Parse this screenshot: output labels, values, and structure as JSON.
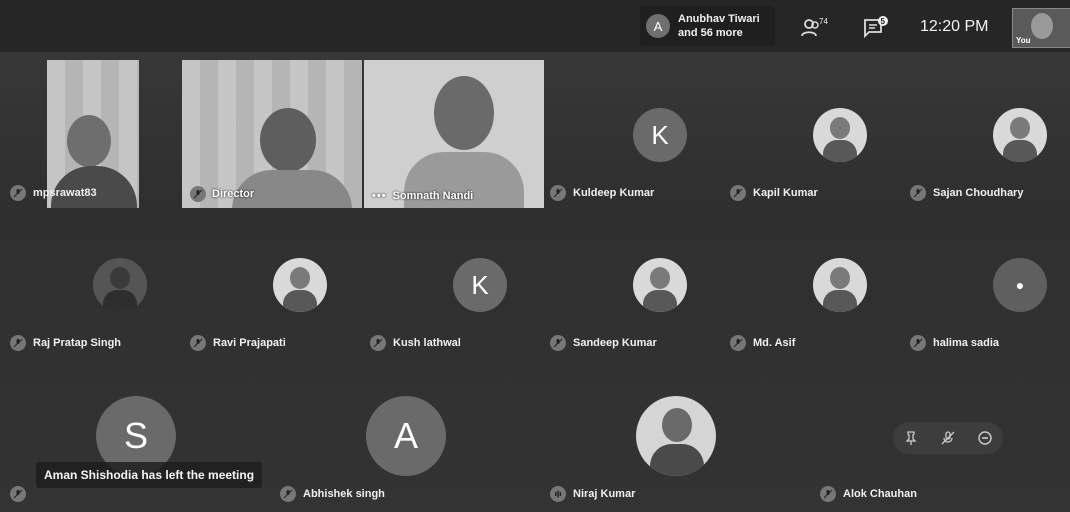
{
  "header": {
    "notification": {
      "avatar_letter": "A",
      "line1": "Anubhav Tiwari",
      "line2": "and 56 more"
    },
    "participant_count": "74",
    "chat_badge": "5",
    "time": "12:20 PM",
    "self_label": "You"
  },
  "video_tiles": [
    {
      "name": "mpsrawat83"
    },
    {
      "name": "Director"
    },
    {
      "name": "Somnath Nandi"
    }
  ],
  "row1": [
    {
      "name": "Kuldeep Kumar",
      "avatar": "K",
      "kind": "letter"
    },
    {
      "name": "Kapil Kumar",
      "avatar": "",
      "kind": "photo"
    },
    {
      "name": "Sajan Choudhary",
      "avatar": "",
      "kind": "photo"
    }
  ],
  "row2": [
    {
      "name": "Raj Pratap Singh",
      "avatar": "",
      "kind": "dark"
    },
    {
      "name": "Ravi Prajapati",
      "avatar": "",
      "kind": "photo"
    },
    {
      "name": "Kush lathwal",
      "avatar": "K",
      "kind": "letter"
    },
    {
      "name": "Sandeep Kumar",
      "avatar": "",
      "kind": "photo"
    },
    {
      "name": "Md. Asif",
      "avatar": "",
      "kind": "photo"
    },
    {
      "name": "halima sadia",
      "avatar": "",
      "kind": "apple"
    }
  ],
  "row3": [
    {
      "name": "Abhishek singh",
      "avatar": "A"
    },
    {
      "name": "Niraj Kumar",
      "avatar": ""
    },
    {
      "name": "Alok Chauhan",
      "avatar": ""
    }
  ],
  "row3_first_avatar": "S",
  "toast": "Aman Shishodia has left the meeting"
}
